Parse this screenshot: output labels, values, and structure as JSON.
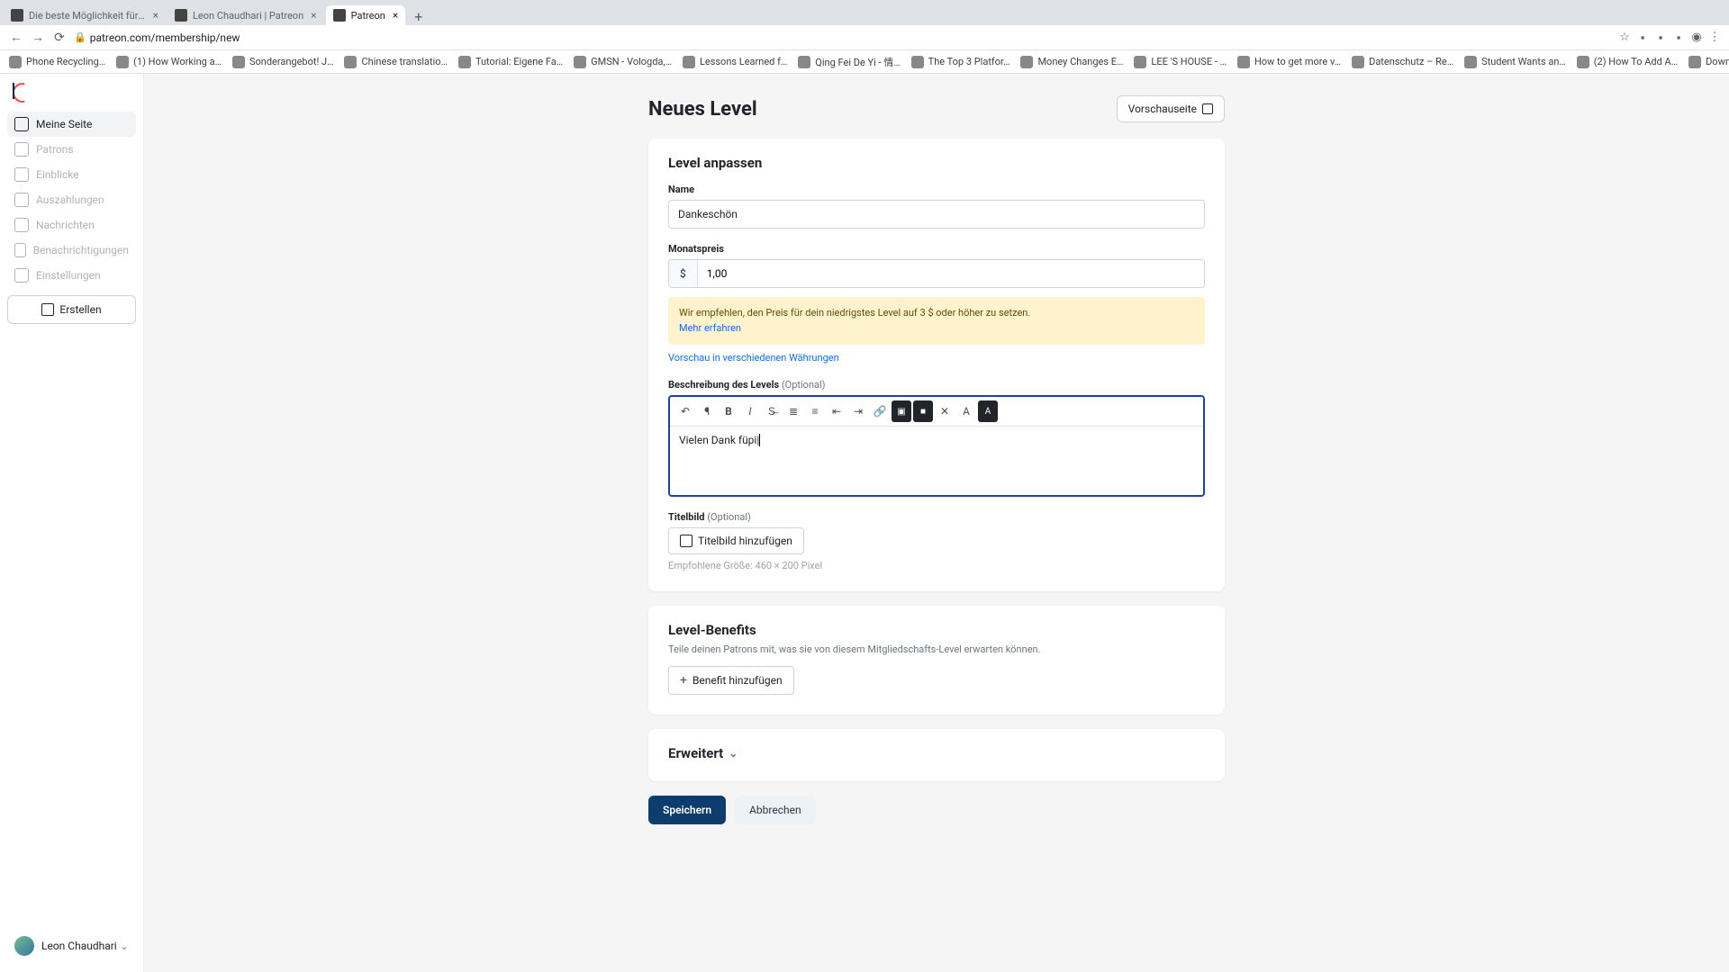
{
  "browser": {
    "tabs": [
      {
        "title": "Die beste Möglichkeit für Kün…"
      },
      {
        "title": "Leon Chaudhari | Patreon"
      },
      {
        "title": "Patreon"
      }
    ],
    "url": "patreon.com/membership/new",
    "bookmarks": [
      {
        "label": "Phone Recycling…"
      },
      {
        "label": "(1) How Working a…"
      },
      {
        "label": "Sonderangebot! J…"
      },
      {
        "label": "Chinese translatio…"
      },
      {
        "label": "Tutorial: Eigene Fa…"
      },
      {
        "label": "GMSN - Vologda,…"
      },
      {
        "label": "Lessons Learned f…"
      },
      {
        "label": "Qing Fei De Yi - 情…"
      },
      {
        "label": "The Top 3 Platfor…"
      },
      {
        "label": "Money Changes E…"
      },
      {
        "label": "LEE 'S HOUSE - …"
      },
      {
        "label": "How to get more v…"
      },
      {
        "label": "Datenschutz – Re…"
      },
      {
        "label": "Student Wants an…"
      },
      {
        "label": "(2) How To Add A…"
      },
      {
        "label": "Download - Cooki…"
      }
    ]
  },
  "sidebar": {
    "items": [
      {
        "label": "Meine Seite",
        "active": true
      },
      {
        "label": "Patrons"
      },
      {
        "label": "Einblicke"
      },
      {
        "label": "Auszahlungen"
      },
      {
        "label": "Nachrichten"
      },
      {
        "label": "Benachrichtigungen"
      },
      {
        "label": "Einstellungen"
      }
    ],
    "create": "Erstellen",
    "user": "Leon Chaudhari"
  },
  "page": {
    "title": "Neues Level",
    "preview": "Vorschauseite"
  },
  "customize": {
    "heading": "Level anpassen",
    "nameLabel": "Name",
    "nameValue": "Dankeschön",
    "priceLabel": "Monatspreis",
    "currency": "$",
    "priceValue": "1,00",
    "warnText": "Wir empfehlen, den Preis für dein niedrigstes Level auf 3 $ oder höher zu setzen.",
    "warnLink": "Mehr erfahren",
    "currencyPreview": "Vorschau in verschiedenen Währungen",
    "descLabel": "Beschreibung des Levels",
    "optional": "(Optional)",
    "descValue": "Vielen Dank füpi",
    "imageLabel": "Titelbild",
    "imageBtn": "Titelbild hinzufügen",
    "imageHint": "Empfohlene Größe: 460 × 200 Pixel"
  },
  "benefits": {
    "heading": "Level-Benefits",
    "sub": "Teile deinen Patrons mit, was sie von diesem Mitgliedschafts-Level erwarten können.",
    "add": "Benefit hinzufügen"
  },
  "advanced": {
    "heading": "Erweitert"
  },
  "actions": {
    "save": "Speichern",
    "cancel": "Abbrechen"
  }
}
